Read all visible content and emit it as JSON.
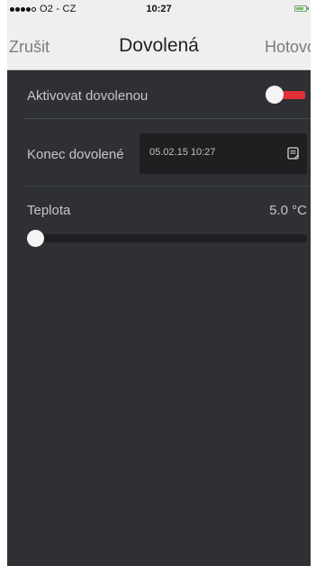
{
  "status_bar": {
    "signal_filled": 4,
    "signal_total": 5,
    "carrier": "O2 - CZ",
    "time": "10:27",
    "battery_color": "#7bbf6a"
  },
  "nav": {
    "cancel_label": "Zrušit",
    "title": "Dovolená",
    "done_label": "Hotovo"
  },
  "vacation": {
    "label": "Aktivovat dovolenou",
    "enabled": true,
    "toggle_color": "#e12f35"
  },
  "end_date": {
    "label": "Konec dovolené",
    "value": "05.02.15 10:27",
    "icon": "calendar-icon"
  },
  "temperature": {
    "label": "Teplota",
    "value_text": "5.0 °C",
    "slider_fraction": 0.0
  },
  "colors": {
    "background": "#2e3033",
    "bar": "#efeff0",
    "accent_red": "#e12f35"
  }
}
